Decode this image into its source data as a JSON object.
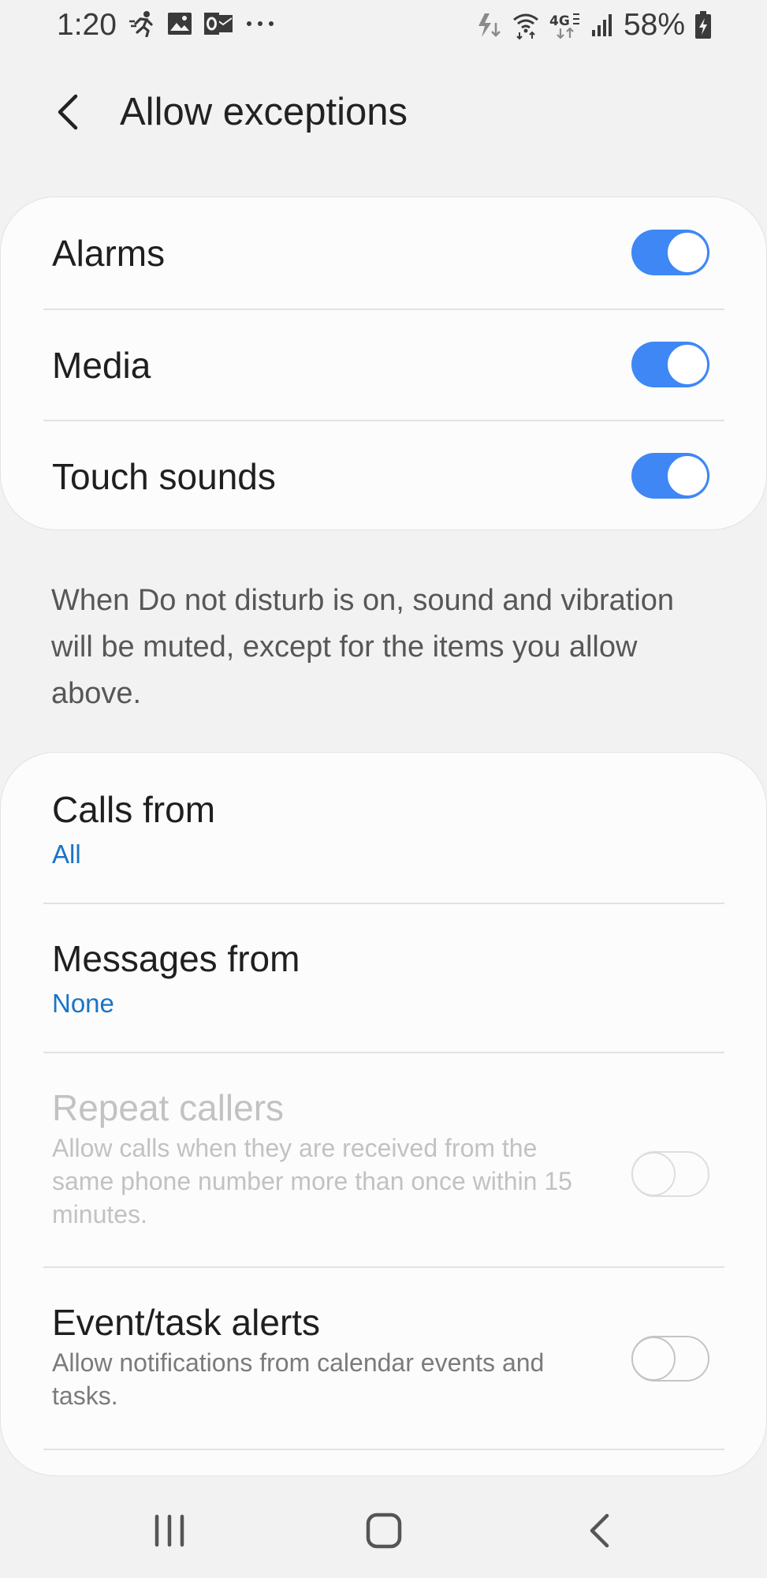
{
  "status_bar": {
    "time": "1:20",
    "battery_percent": "58%",
    "left_icons": [
      "fitness-icon",
      "gallery-icon",
      "outlook-icon",
      "more-notifications-icon"
    ],
    "right_icons": [
      "nfc-data-icon",
      "wifi-icon",
      "lte-icon",
      "signal-icon",
      "battery-charging-icon"
    ]
  },
  "header": {
    "title": "Allow exceptions",
    "back_icon": "chevron-left-icon"
  },
  "sound_exceptions": [
    {
      "label": "Alarms",
      "enabled": true
    },
    {
      "label": "Media",
      "enabled": true
    },
    {
      "label": "Touch sounds",
      "enabled": true
    }
  ],
  "description": "When Do not disturb is on, sound and vibration will be muted, except for the items you allow above.",
  "contact_exceptions": {
    "calls_from": {
      "label": "Calls from",
      "value": "All"
    },
    "messages_from": {
      "label": "Messages from",
      "value": "None"
    },
    "repeat_callers": {
      "label": "Repeat callers",
      "description": "Allow calls when they are received from the same phone number more than once within 15 minutes.",
      "enabled": false,
      "disabled": true
    },
    "event_task_alerts": {
      "label": "Event/task alerts",
      "description": "Allow notifications from calendar events and tasks.",
      "enabled": false
    }
  },
  "colors": {
    "accent": "#3f87f5",
    "link": "#1a73c8",
    "background": "#f2f2f2",
    "card": "#fcfcfc"
  },
  "navigation_bar": [
    "recent-apps-icon",
    "home-icon",
    "back-icon"
  ]
}
